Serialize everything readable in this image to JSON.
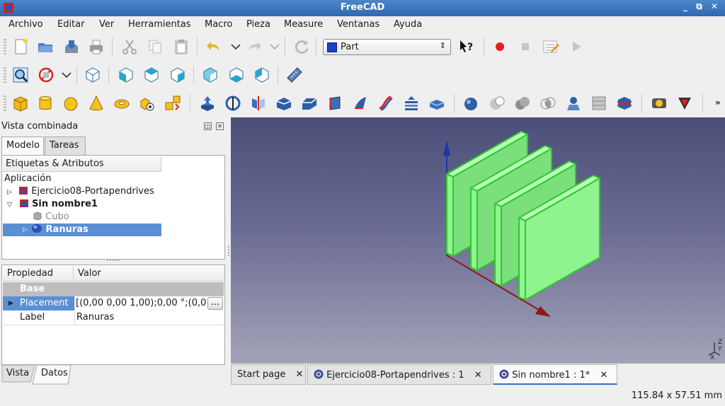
{
  "window": {
    "title": "FreeCAD",
    "controls": "_ ⧉ ✕"
  },
  "menu": [
    "Archivo",
    "Editar",
    "Ver",
    "Herramientas",
    "Macro",
    "Pieza",
    "Measure",
    "Ventanas",
    "Ayuda"
  ],
  "workbench": {
    "selected": "Part"
  },
  "combo_view": {
    "title": "Vista combinada"
  },
  "tabs": {
    "model": "Modelo",
    "tasks": "Tareas"
  },
  "tree": {
    "header": "Etiquetas & Atributos",
    "app_label": "Aplicación",
    "doc1": "Ejercicio08-Portapendrives",
    "doc2": "Sin nombre1",
    "cube": "Cubo",
    "slots": "Ranuras"
  },
  "properties": {
    "col_property": "Propiedad",
    "col_value": "Valor",
    "group": "Base",
    "placement_name": "Placement",
    "placement_value": "[(0,00 0,00 1,00);0,00 °;(0,00",
    "more_btn": "...",
    "label_name": "Label",
    "label_value": "Ranuras"
  },
  "bottom_tabs": {
    "view": "Vista",
    "data": "Datos"
  },
  "view_tabs": [
    {
      "label": "Start page",
      "close": "✕"
    },
    {
      "label": "Ejercicio08-Portapendrives : 1",
      "close": "✕"
    },
    {
      "label": "Sin nombre1 : 1*",
      "close": "✕"
    }
  ],
  "status": {
    "dimensions": "115.84 x 57.51 mm"
  },
  "axis_labels": {
    "z": "Z",
    "y": "Y",
    "x": "X"
  },
  "colors": {
    "accent": "#3a74c4",
    "selection": "#5a8fd4",
    "model_fill": "#8ff38f",
    "model_edge": "#2ec82e"
  }
}
